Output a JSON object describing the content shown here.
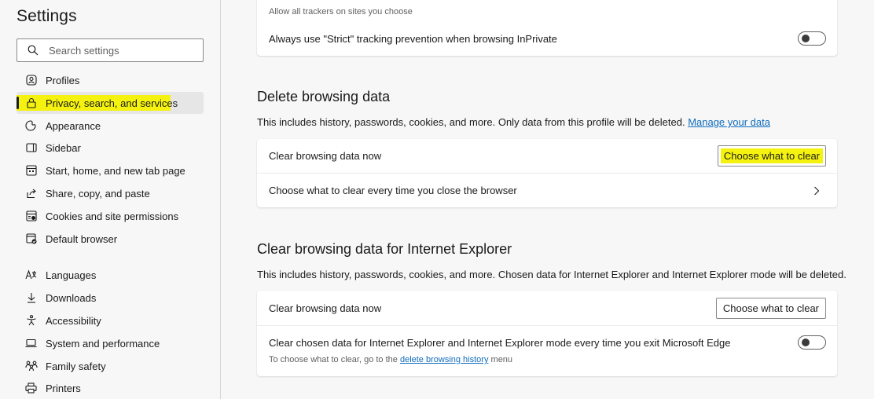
{
  "sidebar": {
    "title": "Settings",
    "search_placeholder": "Search settings",
    "items": [
      {
        "label": "Profiles",
        "icon": "profile-icon"
      },
      {
        "label": "Privacy, search, and services",
        "icon": "lock-icon",
        "active": true
      },
      {
        "label": "Appearance",
        "icon": "appearance-icon"
      },
      {
        "label": "Sidebar",
        "icon": "sidebar-icon"
      },
      {
        "label": "Start, home, and new tab page",
        "icon": "home-tab-icon"
      },
      {
        "label": "Share, copy, and paste",
        "icon": "share-icon"
      },
      {
        "label": "Cookies and site permissions",
        "icon": "cookies-icon"
      },
      {
        "label": "Default browser",
        "icon": "default-browser-icon"
      },
      {
        "label": "Languages",
        "icon": "languages-icon"
      },
      {
        "label": "Downloads",
        "icon": "download-icon"
      },
      {
        "label": "Accessibility",
        "icon": "accessibility-icon"
      },
      {
        "label": "System and performance",
        "icon": "laptop-icon"
      },
      {
        "label": "Family safety",
        "icon": "family-icon"
      },
      {
        "label": "Printers",
        "icon": "printer-icon"
      }
    ]
  },
  "tracking": {
    "partial_note": "Allow all trackers on sites you choose",
    "strict_label": "Always use \"Strict\" tracking prevention when browsing InPrivate",
    "strict_on": false
  },
  "delete": {
    "title": "Delete browsing data",
    "desc": "This includes history, passwords, cookies, and more. Only data from this profile will be deleted.",
    "desc_link": "Manage your data",
    "clear_now_label": "Clear browsing data now",
    "clear_button": "Choose what to clear",
    "on_close_label": "Choose what to clear every time you close the browser"
  },
  "ie": {
    "title": "Clear browsing data for Internet Explorer",
    "desc": "This includes history, passwords, cookies, and more. Chosen data for Internet Explorer and Internet Explorer mode will be deleted.",
    "clear_now_label": "Clear browsing data now",
    "clear_button": "Choose what to clear",
    "exit_label": "Clear chosen data for Internet Explorer and Internet Explorer mode every time you exit Microsoft Edge",
    "exit_on": false,
    "exit_note_prefix": "To choose what to clear, go to the",
    "exit_note_link": "delete browsing history",
    "exit_note_suffix": "menu"
  },
  "colors": {
    "highlight": "#f5f20f",
    "link": "#0f6cbd",
    "background": "#f7f7f7"
  }
}
